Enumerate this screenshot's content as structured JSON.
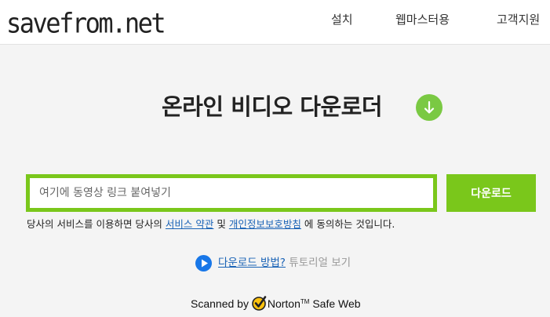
{
  "header": {
    "logo": "savefrom.net",
    "nav": {
      "install": "설치",
      "webmaster": "웹마스터용",
      "support": "고객지원"
    }
  },
  "hero": {
    "title": "온라인 비디오 다운로더",
    "title_icon": "arrow-down-circle-icon"
  },
  "search": {
    "placeholder": "여기에 동영상 링크 붙여넣기",
    "value": "",
    "button_label": "다운로드"
  },
  "terms": {
    "prefix": "당사의 서비스를 이용하면 당사의",
    "link_terms": "서비스 약관",
    "middle": "및",
    "link_privacy": "개인정보보호방침",
    "suffix": "에 동의하는 것입니다."
  },
  "tutorial": {
    "icon": "play-circle-icon",
    "link_label": "다운로드 방법?",
    "rest": "튜토리얼 보기"
  },
  "scanned": {
    "prefix": "Scanned by",
    "brand": "Norton",
    "tm": "TM",
    "suffix": "Safe Web"
  },
  "colors": {
    "accent_green": "#7ac71b",
    "title_icon_green": "#7ac943",
    "link_blue": "#1a63b6",
    "play_blue": "#1877e8",
    "norton_yellow": "#ffc20e",
    "background": "#f4f4f4"
  }
}
